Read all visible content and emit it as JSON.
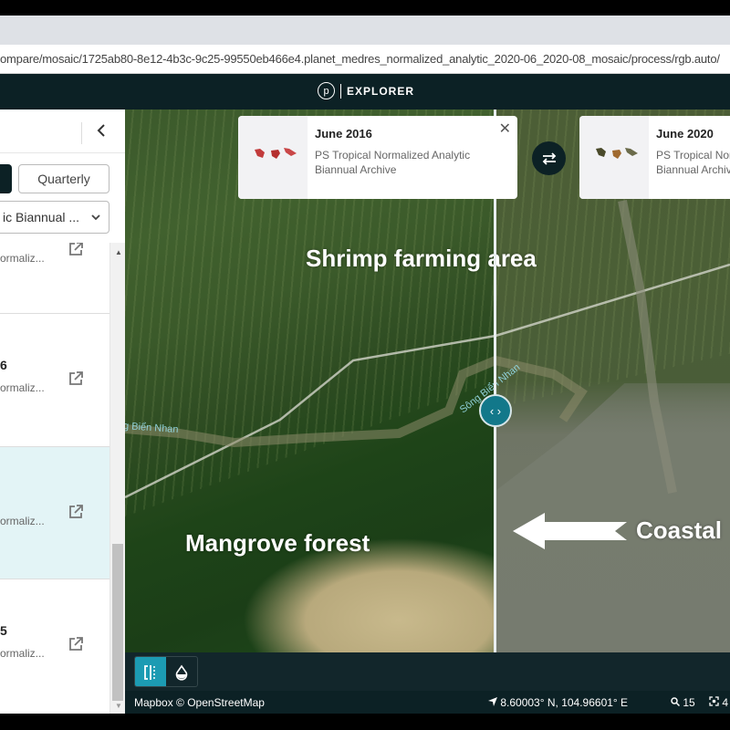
{
  "browser": {
    "url": "ompare/mosaic/1725ab80-8e12-4b3c-9c25-99550eb466e4.planet_medres_normalized_analytic_2020-06_2020-08_mosaic/process/rgb.auto/"
  },
  "header": {
    "logo_letter": "p",
    "title": "EXPLORER"
  },
  "sidebar": {
    "collapse_icon": "chevron-left-icon",
    "cadence_buttons": [
      {
        "label": "",
        "active": true
      },
      {
        "label": "Quarterly",
        "active": false
      }
    ],
    "mosaic_select": {
      "value": "ic Biannual ..."
    },
    "items": [
      {
        "title": "",
        "subtitle": "ormaliz...",
        "active": false
      },
      {
        "title": "6",
        "subtitle": "ormaliz...",
        "active": false
      },
      {
        "title": "",
        "subtitle": "ormaliz...",
        "active": true
      },
      {
        "title": "5",
        "subtitle": "ormaliz...",
        "active": false
      }
    ]
  },
  "compare": {
    "left_card": {
      "title": "June 2016",
      "subtitle_line1": "PS Tropical Normalized Analytic",
      "subtitle_line2": "Biannual Archive",
      "close_icon": "close-icon"
    },
    "right_card": {
      "title": "June 2020",
      "subtitle_line1": "PS Tropical Normalized Analytic",
      "subtitle_line2": "Biannual Archive"
    },
    "swap_icon": "swap-icon",
    "split_handle_label": "‹ ›"
  },
  "map": {
    "annotations": {
      "shrimp": "Shrimp farming area",
      "mangrove": "Mangrove forest",
      "coastal": "Coastal"
    },
    "river_labels": [
      "Sông Biển Nhan",
      "g Biển Nhan"
    ]
  },
  "toolbar": {
    "modes": [
      {
        "name": "split-compare",
        "active": true
      },
      {
        "name": "opacity",
        "active": false
      }
    ]
  },
  "status": {
    "attribution": "Mapbox © OpenStreetMap",
    "coordinates": "8.60003° N, 104.96601° E",
    "zoom_level": "15",
    "extra": "4"
  },
  "colors": {
    "header_bg": "#0c2125",
    "accent": "#1c9bb3",
    "split_handle": "#12788a",
    "active_item_bg": "#e3f4f6"
  }
}
